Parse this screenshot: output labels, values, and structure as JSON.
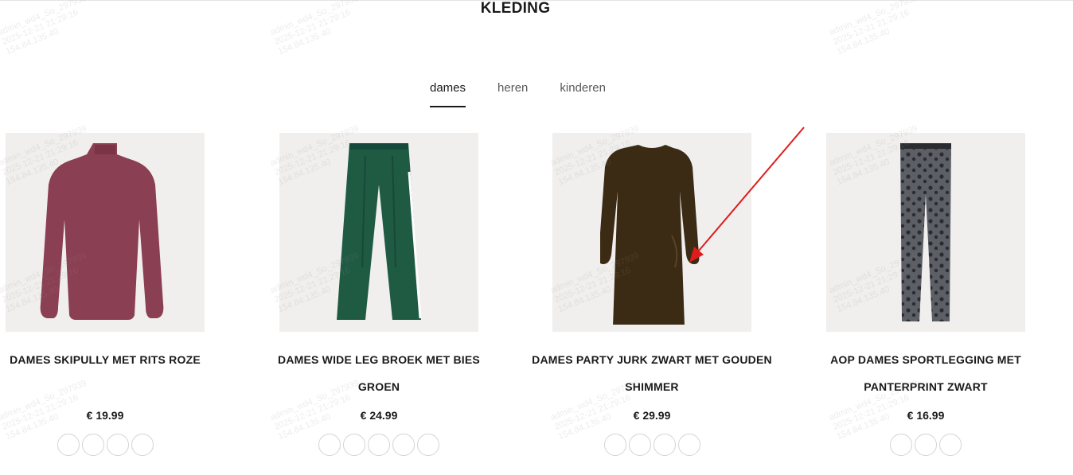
{
  "page": {
    "title": "KLEDING"
  },
  "tabs": [
    {
      "label": "dames",
      "active": true
    },
    {
      "label": "heren",
      "active": false
    },
    {
      "label": "kinderen",
      "active": false
    }
  ],
  "products": [
    {
      "name": "DAMES SKIPULLY MET RITS ROZE",
      "price": "€ 19.99",
      "swatch_count": 4,
      "image": "turtleneck-icon",
      "color": "#8a3f52"
    },
    {
      "name": "DAMES WIDE LEG BROEK MET BIES GROEN",
      "price": "€ 24.99",
      "swatch_count": 5,
      "image": "trousers-icon",
      "color": "#1f5a43"
    },
    {
      "name": "DAMES PARTY JURK ZWART MET GOUDEN SHIMMER",
      "price": "€ 29.99",
      "swatch_count": 4,
      "image": "dress-icon",
      "color": "#3b2a14"
    },
    {
      "name": "AOP DAMES SPORTLEGGING MET PANTERPRINT ZWART",
      "price": "€ 16.99",
      "swatch_count": 3,
      "image": "leggings-icon",
      "color": "#5c5f66"
    }
  ],
  "annotation": {
    "color": "#e01b1b"
  },
  "watermark": {
    "line1": "admin_wd4_So_297939",
    "line2": "2025-12-21 21:29:16",
    "line3": "154.84.135.40"
  }
}
